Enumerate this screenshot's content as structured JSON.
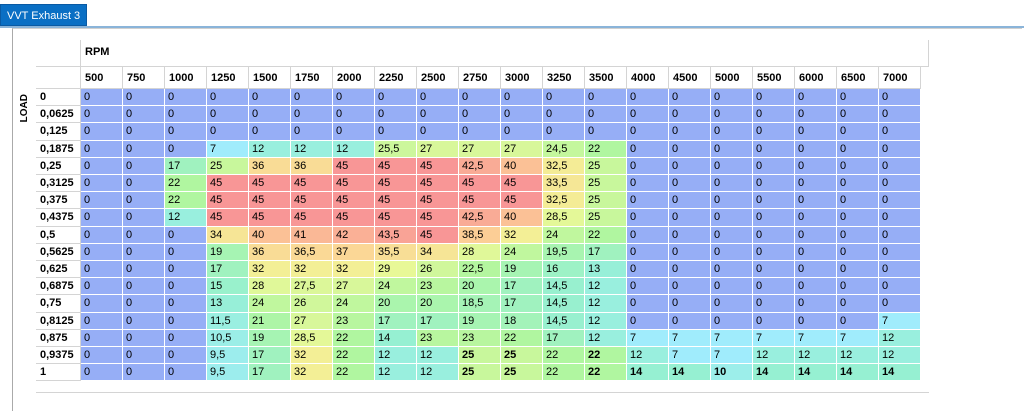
{
  "tab": {
    "label": "VVT Exhaust 3"
  },
  "axes": {
    "x_title": "RPM",
    "y_title": "LOAD"
  },
  "rpm": [
    "500",
    "750",
    "1000",
    "1250",
    "1500",
    "1750",
    "2000",
    "2250",
    "2500",
    "2750",
    "3000",
    "3250",
    "3500",
    "4000",
    "4500",
    "5000",
    "5500",
    "6000",
    "6500",
    "7000"
  ],
  "load": [
    "0",
    "0,0625",
    "0,125",
    "0,1875",
    "0,25",
    "0,3125",
    "0,375",
    "0,4375",
    "0,5",
    "0,5625",
    "0,625",
    "0,6875",
    "0,75",
    "0,8125",
    "0,875",
    "0,9375",
    "1"
  ],
  "table": [
    [
      "0",
      "0",
      "0",
      "0",
      "0",
      "0",
      "0",
      "0",
      "0",
      "0",
      "0",
      "0",
      "0",
      "0",
      "0",
      "0",
      "0",
      "0",
      "0",
      "0"
    ],
    [
      "0",
      "0",
      "0",
      "0",
      "0",
      "0",
      "0",
      "0",
      "0",
      "0",
      "0",
      "0",
      "0",
      "0",
      "0",
      "0",
      "0",
      "0",
      "0",
      "0"
    ],
    [
      "0",
      "0",
      "0",
      "0",
      "0",
      "0",
      "0",
      "0",
      "0",
      "0",
      "0",
      "0",
      "0",
      "0",
      "0",
      "0",
      "0",
      "0",
      "0",
      "0"
    ],
    [
      "0",
      "0",
      "0",
      "7",
      "12",
      "12",
      "12",
      "25,5",
      "27",
      "27",
      "27",
      "24,5",
      "22",
      "0",
      "0",
      "0",
      "0",
      "0",
      "0",
      "0"
    ],
    [
      "0",
      "0",
      "17",
      "25",
      "36",
      "36",
      "45",
      "45",
      "45",
      "42,5",
      "40",
      "32,5",
      "25",
      "0",
      "0",
      "0",
      "0",
      "0",
      "0",
      "0"
    ],
    [
      "0",
      "0",
      "22",
      "45",
      "45",
      "45",
      "45",
      "45",
      "45",
      "45",
      "45",
      "33,5",
      "25",
      "0",
      "0",
      "0",
      "0",
      "0",
      "0",
      "0"
    ],
    [
      "0",
      "0",
      "22",
      "45",
      "45",
      "45",
      "45",
      "45",
      "45",
      "45",
      "45",
      "32,5",
      "25",
      "0",
      "0",
      "0",
      "0",
      "0",
      "0",
      "0"
    ],
    [
      "0",
      "0",
      "12",
      "45",
      "45",
      "45",
      "45",
      "45",
      "45",
      "42,5",
      "40",
      "28,5",
      "25",
      "0",
      "0",
      "0",
      "0",
      "0",
      "0",
      "0"
    ],
    [
      "0",
      "0",
      "0",
      "34",
      "40",
      "41",
      "42",
      "43,5",
      "45",
      "38,5",
      "32",
      "24",
      "22",
      "0",
      "0",
      "0",
      "0",
      "0",
      "0",
      "0"
    ],
    [
      "0",
      "0",
      "0",
      "19",
      "36",
      "36,5",
      "37",
      "35,5",
      "34",
      "28",
      "24",
      "19,5",
      "17",
      "0",
      "0",
      "0",
      "0",
      "0",
      "0",
      "0"
    ],
    [
      "0",
      "0",
      "0",
      "17",
      "32",
      "32",
      "32",
      "29",
      "26",
      "22,5",
      "19",
      "16",
      "13",
      "0",
      "0",
      "0",
      "0",
      "0",
      "0",
      "0"
    ],
    [
      "0",
      "0",
      "0",
      "15",
      "28",
      "27,5",
      "27",
      "24",
      "23",
      "20",
      "17",
      "14,5",
      "12",
      "0",
      "0",
      "0",
      "0",
      "0",
      "0",
      "0"
    ],
    [
      "0",
      "0",
      "0",
      "13",
      "24",
      "26",
      "24",
      "20",
      "20",
      "18,5",
      "17",
      "14,5",
      "12",
      "0",
      "0",
      "0",
      "0",
      "0",
      "0",
      "0"
    ],
    [
      "0",
      "0",
      "0",
      "11,5",
      "21",
      "27",
      "23",
      "17",
      "17",
      "19",
      "18",
      "14,5",
      "12",
      "0",
      "0",
      "0",
      "0",
      "0",
      "0",
      "7"
    ],
    [
      "0",
      "0",
      "0",
      "10,5",
      "19",
      "28,5",
      "22",
      "14",
      "23",
      "23",
      "22",
      "17",
      "12",
      "7",
      "7",
      "7",
      "7",
      "7",
      "7",
      "12"
    ],
    [
      "0",
      "0",
      "0",
      "9,5",
      "17",
      "32",
      "22",
      "12",
      "12",
      "25",
      "25",
      "22",
      "22",
      "12",
      "7",
      "7",
      "12",
      "12",
      "12",
      "12"
    ],
    [
      "0",
      "0",
      "0",
      "9,5",
      "17",
      "32",
      "22",
      "12",
      "12",
      "25",
      "25",
      "22",
      "22",
      "14",
      "14",
      "10",
      "14",
      "14",
      "14",
      "14"
    ]
  ],
  "bold_cells": [
    [
      15,
      9
    ],
    [
      15,
      10
    ],
    [
      15,
      12
    ],
    [
      16,
      9
    ],
    [
      16,
      10
    ],
    [
      16,
      12
    ],
    [
      16,
      13
    ],
    [
      16,
      14
    ],
    [
      16,
      15
    ],
    [
      16,
      16
    ],
    [
      16,
      17
    ],
    [
      16,
      18
    ],
    [
      16,
      19
    ]
  ]
}
